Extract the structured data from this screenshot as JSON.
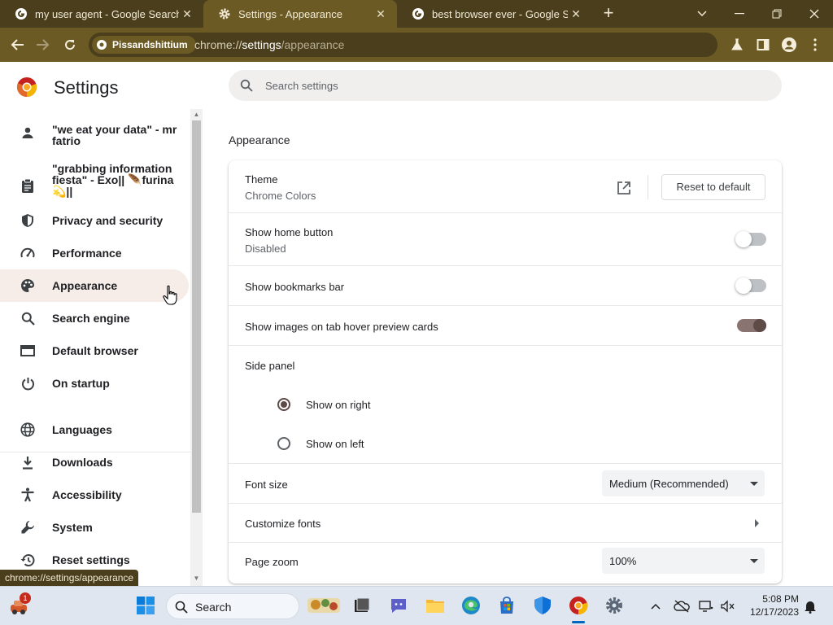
{
  "browser": {
    "tabs": [
      {
        "title": "my user agent - Google Search",
        "active": false,
        "icon": "google-g-icon"
      },
      {
        "title": "Settings - Appearance",
        "active": true,
        "icon": "gear-icon"
      },
      {
        "title": "best browser ever - Google Search",
        "active": false,
        "icon": "google-g-icon"
      }
    ],
    "profile_chip": "Pissandshittium",
    "url_scheme": "chrome://",
    "url_host": "settings",
    "url_path": "/appearance",
    "status_url": "chrome://settings/appearance"
  },
  "settings": {
    "title": "Settings",
    "search_placeholder": "Search settings",
    "nav": [
      {
        "label": "\"we eat your data\" - mr fatrio",
        "icon": "person-icon"
      },
      {
        "label": "\"grabbing information fiesta\" - Exo|| 🪶furina 💫||",
        "icon": "clipboard-icon"
      },
      {
        "label": "Privacy and security",
        "icon": "shield-icon"
      },
      {
        "label": "Performance",
        "icon": "speedometer-icon"
      },
      {
        "label": "Appearance",
        "icon": "palette-icon",
        "selected": true
      },
      {
        "label": "Search engine",
        "icon": "search-icon"
      },
      {
        "label": "Default browser",
        "icon": "browser-window-icon"
      },
      {
        "label": "On startup",
        "icon": "power-icon"
      },
      {
        "label": "Languages",
        "icon": "globe-icon"
      },
      {
        "label": "Downloads",
        "icon": "download-icon"
      },
      {
        "label": "Accessibility",
        "icon": "accessibility-icon"
      },
      {
        "label": "System",
        "icon": "wrench-icon"
      },
      {
        "label": "Reset settings",
        "icon": "history-icon"
      }
    ],
    "section_title": "Appearance",
    "theme": {
      "label": "Theme",
      "value": "Chrome Colors",
      "reset_label": "Reset to default"
    },
    "home_button": {
      "label": "Show home button",
      "value": "Disabled",
      "enabled": false
    },
    "bookmarks_bar": {
      "label": "Show bookmarks bar",
      "enabled": false
    },
    "tab_hover": {
      "label": "Show images on tab hover preview cards",
      "enabled": true
    },
    "side_panel": {
      "label": "Side panel",
      "options": [
        "Show on right",
        "Show on left"
      ],
      "selected": "Show on right"
    },
    "font_size": {
      "label": "Font size",
      "value": "Medium (Recommended)"
    },
    "customize_fonts": {
      "label": "Customize fonts"
    },
    "page_zoom": {
      "label": "Page zoom",
      "value": "100%"
    }
  },
  "taskbar": {
    "search_label": "Search",
    "time": "5:08 PM",
    "date": "12/17/2023",
    "notification_badge": "1",
    "accent": "#0067c0"
  },
  "colors": {
    "frame": "#4a3e1d",
    "toolbar": "#6b5a23",
    "selected_nav_bg": "#f6ece8",
    "toggle_on": "#8a7472"
  }
}
